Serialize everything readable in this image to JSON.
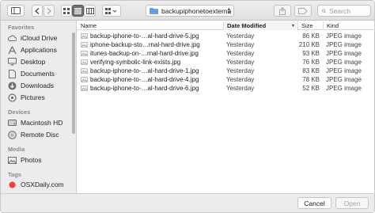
{
  "toolbar": {
    "path_label": "backupiphonetoexternal",
    "search_placeholder": "Search"
  },
  "sidebar": {
    "sections": [
      {
        "title": "Favorites",
        "items": [
          {
            "label": "iCloud Drive",
            "icon": "cloud-icon"
          },
          {
            "label": "Applications",
            "icon": "applications-icon"
          },
          {
            "label": "Desktop",
            "icon": "desktop-icon"
          },
          {
            "label": "Documents",
            "icon": "documents-icon"
          },
          {
            "label": "Downloads",
            "icon": "downloads-icon"
          },
          {
            "label": "Pictures",
            "icon": "pictures-icon"
          }
        ]
      },
      {
        "title": "Devices",
        "items": [
          {
            "label": "Macintosh HD",
            "icon": "hard-drive-icon"
          },
          {
            "label": "Remote Disc",
            "icon": "disc-icon"
          }
        ]
      },
      {
        "title": "Media",
        "items": [
          {
            "label": "Photos",
            "icon": "photos-icon"
          }
        ]
      },
      {
        "title": "Tags",
        "items": [
          {
            "label": "OSXDaily.com",
            "icon": "red-tag-icon"
          }
        ]
      }
    ]
  },
  "filelist": {
    "columns": {
      "name": "Name",
      "date": "Date Modified",
      "size": "Size",
      "kind": "Kind"
    },
    "rows": [
      {
        "name": "backup-iphone-to-…al-hard-drive-5.jpg",
        "date": "Yesterday",
        "size": "86 KB",
        "kind": "JPEG image"
      },
      {
        "name": "iphone-backup-sto…rnal-hard-drive.jpg",
        "date": "Yesterday",
        "size": "210 KB",
        "kind": "JPEG image"
      },
      {
        "name": "itunes-backup-on-…rnal-hard-drive.jpg",
        "date": "Yesterday",
        "size": "93 KB",
        "kind": "JPEG image"
      },
      {
        "name": "verifying-symbolic-link-exists.jpg",
        "date": "Yesterday",
        "size": "76 KB",
        "kind": "JPEG image"
      },
      {
        "name": "backup-iphone-to-…al-hard-drive-1.jpg",
        "date": "Yesterday",
        "size": "83 KB",
        "kind": "JPEG image"
      },
      {
        "name": "backup-iphone-to-…al-hard-drive-4.jpg",
        "date": "Yesterday",
        "size": "78 KB",
        "kind": "JPEG image"
      },
      {
        "name": "backup-iphone-to-…al-hard-drive-6.jpg",
        "date": "Yesterday",
        "size": "52 KB",
        "kind": "JPEG image"
      }
    ]
  },
  "buttons": {
    "cancel": "Cancel",
    "open": "Open"
  },
  "colors": {
    "tag_red": "#e5453c",
    "folder_blue": "#5aa0e6",
    "sidebar_icon": "#6d6d6d"
  }
}
